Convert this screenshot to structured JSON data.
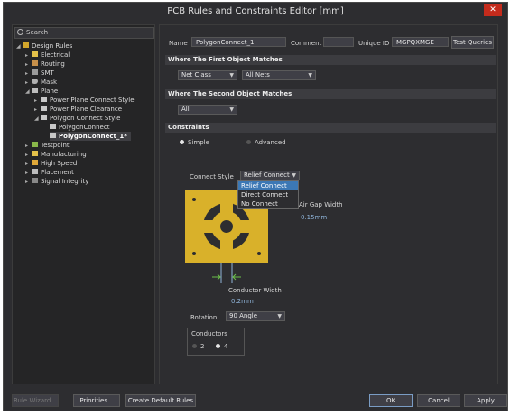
{
  "window": {
    "title": "PCB Rules and Constraints Editor [mm]",
    "close_glyph": "✕"
  },
  "search": {
    "placeholder": "Search"
  },
  "tree": [
    {
      "label": "Design Rules",
      "arrow": "◢",
      "icon_color": "#d4a72c"
    },
    {
      "label": "Electrical",
      "arrow": "▸",
      "icon_color": "#e3c14a"
    },
    {
      "label": "Routing",
      "arrow": "▸",
      "icon_color": "#c7904a"
    },
    {
      "label": "SMT",
      "arrow": "▸",
      "icon_color": "#9b9b9b"
    },
    {
      "label": "Mask",
      "arrow": "▸",
      "icon_color": "#b0b0b0"
    },
    {
      "label": "Plane",
      "arrow": "◢",
      "icon_color": "#bdbdbd"
    },
    {
      "label": "Power Plane Connect Style",
      "arrow": "▸",
      "icon_color": "#c8c8c8"
    },
    {
      "label": "Power Plane Clearance",
      "arrow": "▸",
      "icon_color": "#c8c8c8"
    },
    {
      "label": "Polygon Connect Style",
      "arrow": "◢",
      "icon_color": "#c8c8c8"
    },
    {
      "label": "PolygonConnect",
      "arrow": "",
      "icon_color": "#c8c8c8"
    },
    {
      "label": "PolygonConnect_1*",
      "arrow": "",
      "icon_color": "#c8c8c8"
    },
    {
      "label": "Testpoint",
      "arrow": "▸",
      "icon_color": "#8ab84a"
    },
    {
      "label": "Manufacturing",
      "arrow": "▸",
      "icon_color": "#e3c14a"
    },
    {
      "label": "High Speed",
      "arrow": "▸",
      "icon_color": "#e0a93a"
    },
    {
      "label": "Placement",
      "arrow": "▸",
      "icon_color": "#bdbdbd"
    },
    {
      "label": "Signal Integrity",
      "arrow": "▸",
      "icon_color": "#888888"
    }
  ],
  "header": {
    "name_label": "Name",
    "name_value": "PolygonConnect_1",
    "comment_label": "Comment",
    "comment_value": "",
    "uid_label": "Unique ID",
    "uid_value": "MGPQXMGE",
    "test_queries": "Test Queries"
  },
  "first_match": {
    "title": "Where The First Object Matches",
    "type": "Net Class",
    "value": "All Nets"
  },
  "second_match": {
    "title": "Where The Second Object Matches",
    "type": "All"
  },
  "constraints": {
    "title": "Constraints",
    "simple": "Simple",
    "advanced": "Advanced",
    "connect_style_label": "Connect Style",
    "connect_style_value": "Relief Connect",
    "options": [
      "Relief Connect",
      "Direct Connect",
      "No Connect"
    ],
    "air_gap_label": "Air Gap Width",
    "air_gap_value": "0.15mm",
    "conductor_width_label": "Conductor Width",
    "conductor_width_value": "0.2mm",
    "rotation_label": "Rotation",
    "rotation_value": "90 Angle",
    "conductors_label": "Conductors",
    "conductors_opt_2": "2",
    "conductors_opt_4": "4"
  },
  "footer": {
    "rule_wizard": "Rule Wizard...",
    "priorities": "Priorities...",
    "create_default_rules": "Create Default Rules",
    "ok": "OK",
    "cancel": "Cancel",
    "apply": "Apply"
  },
  "colors": {
    "accent": "#3c78b5",
    "copper": "#d9b12a",
    "close": "#c42b1c",
    "dim_blue": "#8fb4d9"
  }
}
